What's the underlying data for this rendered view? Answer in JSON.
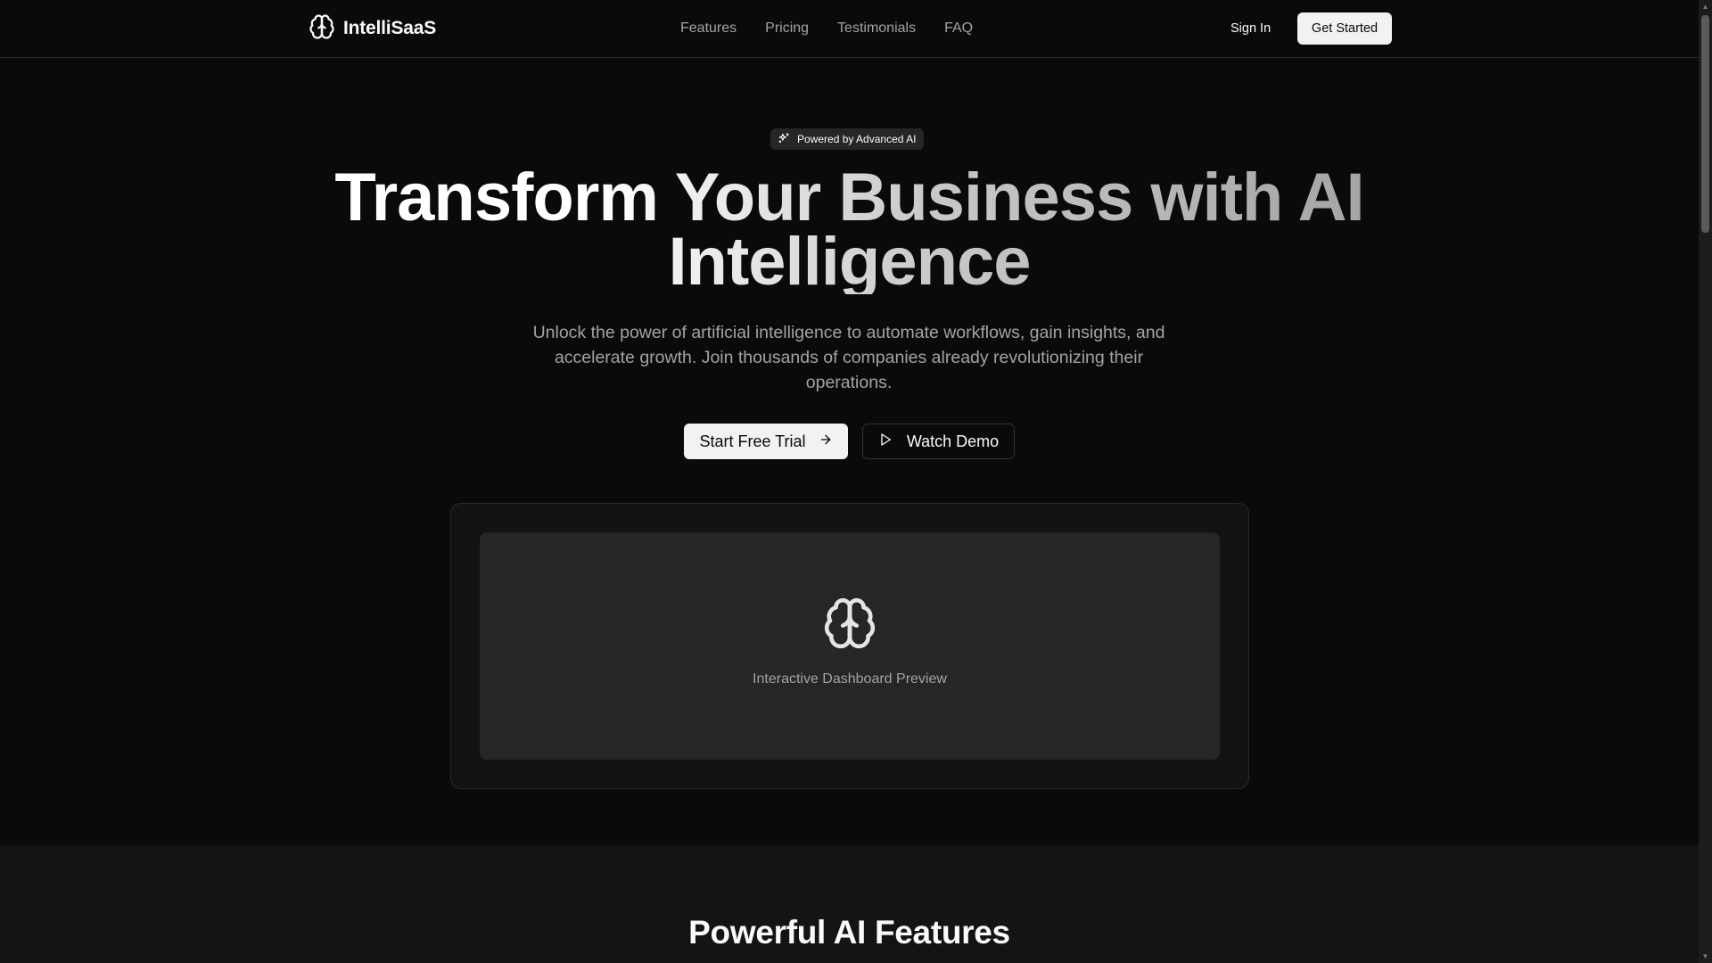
{
  "header": {
    "brand": "IntelliSaaS",
    "nav": [
      "Features",
      "Pricing",
      "Testimonials",
      "FAQ"
    ],
    "sign_in": "Sign In",
    "get_started": "Get Started"
  },
  "hero": {
    "badge": "Powered by Advanced AI",
    "headline_line1": "Transform Your Business with AI",
    "headline_line2": "Intelligence",
    "subtitle": "Unlock the power of artificial intelligence to automate workflows, gain insights, and accelerate growth. Join thousands of companies already revolutionizing their operations.",
    "primary_cta": "Start Free Trial",
    "secondary_cta": "Watch Demo"
  },
  "preview": {
    "label": "Interactive Dashboard Preview",
    "icon": "brain-icon"
  },
  "features": {
    "title": "Powerful AI Features"
  },
  "colors": {
    "background": "#0a0a0a",
    "surface": "#262626",
    "primary_button": "#f2f2f2",
    "muted_text": "#a3a3a3"
  }
}
